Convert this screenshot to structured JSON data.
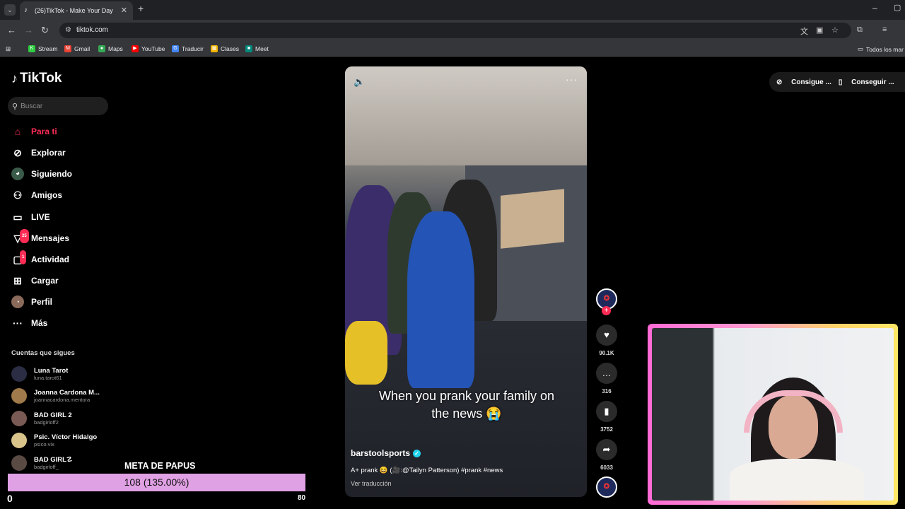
{
  "browser": {
    "tab_title": "(26)TikTok - Make Your Day",
    "url": "tiktok.com",
    "bookmarks": [
      {
        "label": "Stream",
        "color": "#2ecc40"
      },
      {
        "label": "Gmail",
        "color": "#ea4335"
      },
      {
        "label": "Maps",
        "color": "#34a853"
      },
      {
        "label": "YouTube",
        "color": "#ff0000"
      },
      {
        "label": "Traducir",
        "color": "#4285f4"
      },
      {
        "label": "Clases",
        "color": "#f4b400"
      },
      {
        "label": "Meet",
        "color": "#00897b"
      }
    ],
    "all_bookmarks": "Todos los mar"
  },
  "tiktok": {
    "logo": "TikTok",
    "search_placeholder": "Buscar",
    "nav": [
      {
        "label": "Para ti",
        "icon": "home-icon"
      },
      {
        "label": "Explorar",
        "icon": "compass-icon"
      },
      {
        "label": "Siguiendo",
        "icon": "following-icon"
      },
      {
        "label": "Amigos",
        "icon": "friends-icon"
      },
      {
        "label": "LIVE",
        "icon": "live-icon"
      },
      {
        "label": "Mensajes",
        "icon": "messages-icon",
        "badge": "25"
      },
      {
        "label": "Actividad",
        "icon": "activity-icon",
        "badge": "1"
      },
      {
        "label": "Cargar",
        "icon": "upload-icon"
      },
      {
        "label": "Perfil",
        "icon": "profile-icon"
      },
      {
        "label": "Más",
        "icon": "more-icon"
      }
    ],
    "following_title": "Cuentas que sigues",
    "following": [
      {
        "name": "Luna Tarot",
        "handle": "luna.tarot61"
      },
      {
        "name": "Joanna Cardona M...",
        "handle": "joannacardona.mentora"
      },
      {
        "name": "BAD GIRL 2",
        "handle": "badgirloff2"
      },
      {
        "name": "Psic. Víctor Hidalgo",
        "handle": "psico.vix"
      },
      {
        "name": "BAD GIRL☡",
        "handle": "badgirloff_"
      }
    ],
    "video": {
      "caption": "When you prank your family on the news 😭",
      "author": "barstoolsports",
      "description": "A+ prank 😆 (🎥:@Tailyn Patterson) #prank #news",
      "translate": "Ver traducción",
      "likes": "90.1K",
      "comments": "316",
      "saves": "3752",
      "shares": "6033"
    },
    "top_right": [
      "Consigue ...",
      "Conseguir ..."
    ]
  },
  "overlay": {
    "goal_title": "META DE PAPUS",
    "goal_text": "108 (135.00%)",
    "goal_progress": 1.0,
    "goal_min": "0",
    "goal_max": "80"
  }
}
